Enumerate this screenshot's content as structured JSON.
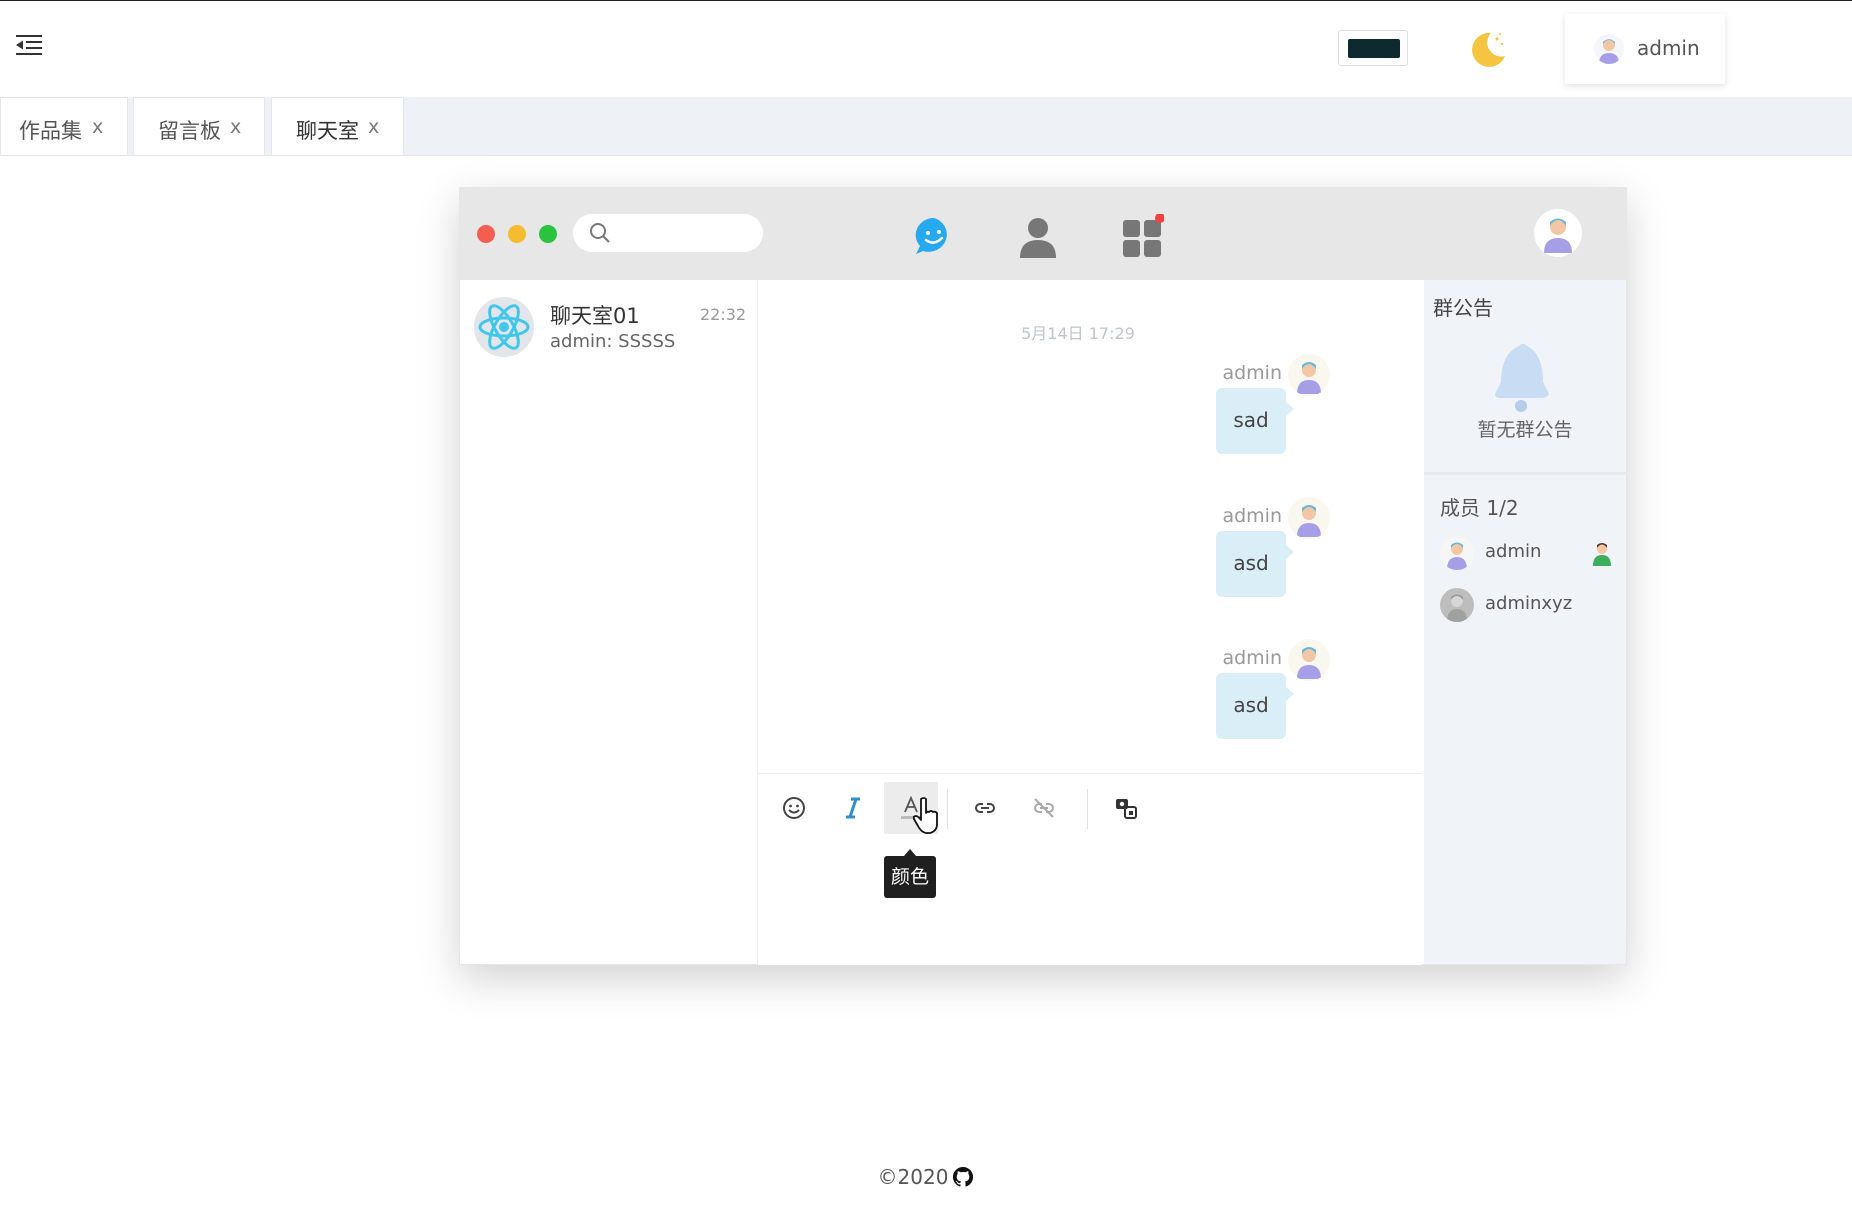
{
  "header": {
    "menu_icon": "indent-menu-icon",
    "theme_icon": "moon-icon",
    "user": {
      "name": "admin",
      "avatar_icon": "user-avatar-icon"
    }
  },
  "tabs": [
    {
      "label": "作品集",
      "close": "x",
      "active": false
    },
    {
      "label": "留言板",
      "close": "x",
      "active": false
    },
    {
      "label": "聊天室",
      "close": "x",
      "active": true
    }
  ],
  "chat": {
    "window_controls": {
      "close_color": "#f55d50",
      "minimize_color": "#f6bc2f",
      "maximize_color": "#29c33f"
    },
    "search": {
      "placeholder": "",
      "icon": "search-icon"
    },
    "nav": [
      {
        "name": "chat",
        "icon": "chat-bubble-icon",
        "active": true,
        "color": "#27a9f0"
      },
      {
        "name": "contacts",
        "icon": "contact-icon",
        "active": false
      },
      {
        "name": "apps",
        "icon": "apps-grid-icon",
        "badge": true
      }
    ],
    "conversations": [
      {
        "name": "聊天室01",
        "time": "22:32",
        "last_message": "admin: SSSSS",
        "icon": "react-logo-icon"
      }
    ],
    "timestamp": "5月14日 17:29",
    "messages": [
      {
        "sender": "admin",
        "text": "sad"
      },
      {
        "sender": "admin",
        "text": "asd"
      },
      {
        "sender": "admin",
        "text": "asd"
      }
    ],
    "toolbar": {
      "tools": [
        {
          "name": "emoji",
          "icon": "emoji-icon"
        },
        {
          "name": "italic",
          "icon": "italic-icon"
        },
        {
          "name": "color",
          "icon": "text-color-icon",
          "hover": true
        },
        {
          "name": "link",
          "icon": "link-icon"
        },
        {
          "name": "unlink",
          "icon": "unlink-icon"
        },
        {
          "name": "image",
          "icon": "image-icon"
        }
      ],
      "tooltip": "颜色"
    },
    "sidebar": {
      "notice_title": "群公告",
      "notice_empty": "暂无群公告",
      "members_title": "成员 1/2",
      "members": [
        {
          "name": "admin",
          "role_icon": "owner-icon",
          "online": true
        },
        {
          "name": "adminxyz",
          "online": false
        }
      ]
    }
  },
  "footer": {
    "text": "©2020",
    "icon": "github-icon"
  }
}
